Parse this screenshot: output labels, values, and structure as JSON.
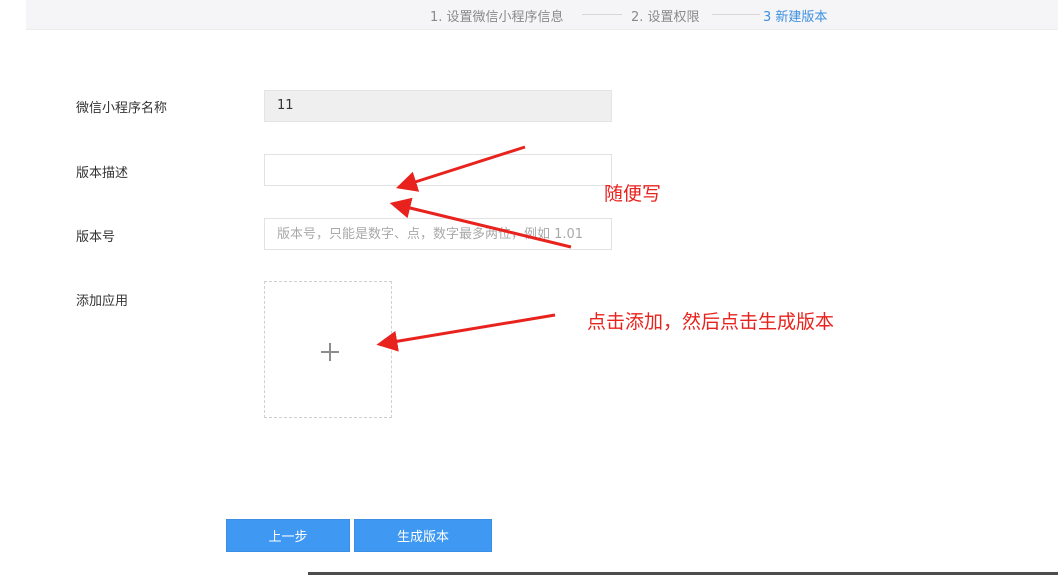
{
  "steps": [
    {
      "label": "1. 设置微信小程序信息",
      "state": "done"
    },
    {
      "label": "2. 设置权限",
      "state": "done"
    },
    {
      "label": "3 新建版本",
      "state": "active"
    }
  ],
  "form": {
    "name_label": "微信小程序名称",
    "name_value": "11",
    "desc_label": "版本描述",
    "desc_value": "",
    "version_label": "版本号",
    "version_placeholder": "版本号，只能是数字、点，数字最多两位，例如 1.01",
    "app_label": "添加应用",
    "upload_icon": "plus-icon"
  },
  "buttons": {
    "prev_label": "上一步",
    "generate_label": "生成版本"
  },
  "annotations": {
    "note_1": "随便写",
    "note_2": "点击添加，然后点击生成版本"
  },
  "colors": {
    "accent": "#3f99f2",
    "active_step": "#3d8fe0",
    "annotation_red": "#e8231e"
  }
}
